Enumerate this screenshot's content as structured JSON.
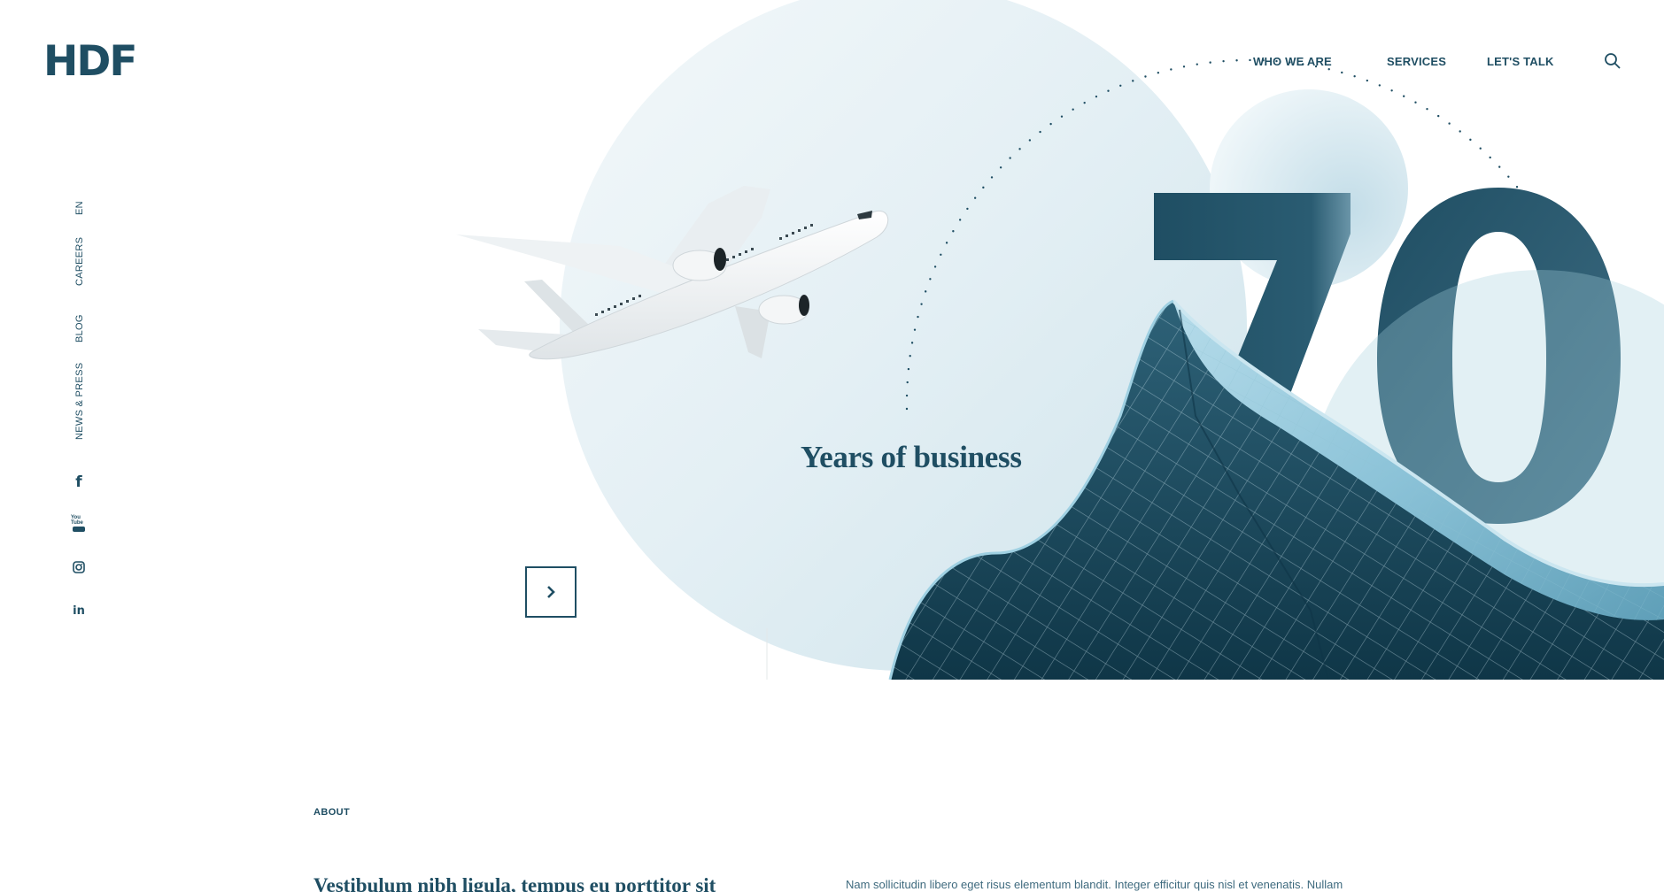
{
  "brand": {
    "logo_text": "HDF"
  },
  "nav": {
    "items": [
      {
        "label": "WHO WE ARE"
      },
      {
        "label": "SERVICES"
      },
      {
        "label": "LET'S TALK"
      }
    ],
    "search_icon": "search-icon"
  },
  "sidebar": {
    "links": [
      {
        "label": "EN"
      },
      {
        "label": "CAREERS"
      },
      {
        "label": "BLOG"
      },
      {
        "label": "NEWS & PRESS"
      }
    ],
    "social": [
      {
        "icon": "facebook-icon",
        "glyph": "f"
      },
      {
        "icon": "youtube-icon",
        "glyph": "You Tube"
      },
      {
        "icon": "instagram-icon",
        "glyph": ""
      },
      {
        "icon": "linkedin-icon",
        "glyph": "in"
      }
    ]
  },
  "hero": {
    "big_number": "70",
    "subtitle": "Years of business",
    "next_icon": "chevron-right-icon"
  },
  "about": {
    "label": "ABOUT",
    "heading": "Vestibulum nibh ligula, tempus eu porttitor sit",
    "text": "Nam sollicitudin libero eget risus elementum blandit. Integer efficitur quis nisl et venenatis. Nullam"
  },
  "colors": {
    "primary": "#1f4e63",
    "circle_light": "#dbeaf0",
    "building_glass": "#8cc3d8"
  }
}
